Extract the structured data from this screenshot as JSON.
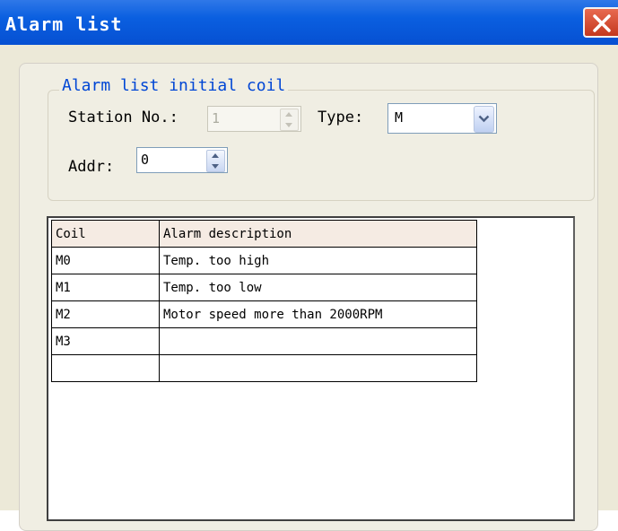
{
  "window": {
    "title": "Alarm list"
  },
  "group": {
    "legend": "Alarm list initial coil",
    "station_label": "Station No.:",
    "station_value": "1",
    "type_label": "Type:",
    "type_value": "M",
    "addr_label": "Addr:",
    "addr_value": "0"
  },
  "table": {
    "headers": [
      "Coil",
      "Alarm description"
    ],
    "rows": [
      [
        "M0",
        "Temp. too high"
      ],
      [
        "M1",
        "Temp. too low"
      ],
      [
        "M2",
        "Motor speed more than 2000RPM"
      ],
      [
        "M3",
        ""
      ],
      [
        "",
        ""
      ]
    ]
  }
}
